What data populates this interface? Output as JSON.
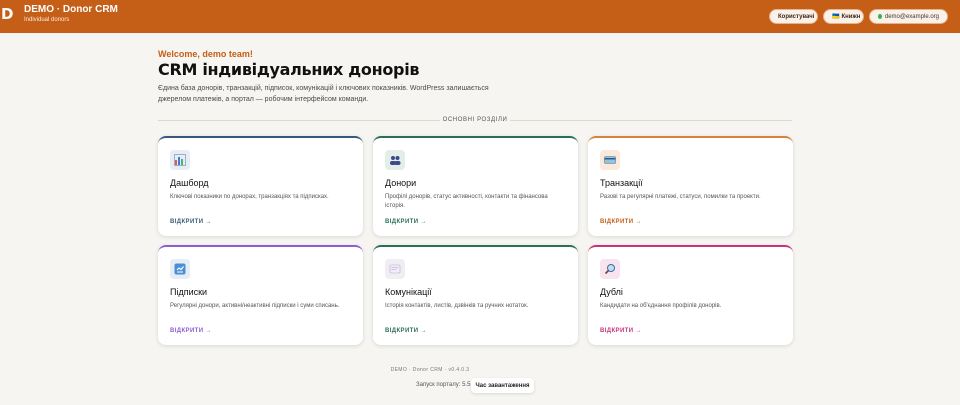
{
  "header": {
    "logo": "D",
    "title": "DEMO · Donor CRM",
    "subtitle": "Individual donors",
    "users_button": "Користувачі",
    "lang_flag": "🇺🇦",
    "lang_button": "Книжн",
    "user_email": "demo@example.org",
    "status_color": "#2fb45a"
  },
  "welcome": "Welcome, demo team!",
  "title": "CRM індивідуальних донорів",
  "lead": "Єдина база донорів, транзакцій, підписок, комунікацій і ключових показників. WordPress залишається джерелом платежів, а портал — робочим інтерфейсом команди.",
  "section_label": "ОСНОВНІ РОЗДІЛИ",
  "cards": [
    {
      "title": "Дашборд",
      "desc": "Ключові показники по донорах, транзакціях та підписках.",
      "link": "ВІДКРИТИ →",
      "icon": "chart-icon",
      "color": "#3a5a7c"
    },
    {
      "title": "Донори",
      "desc": "Профілі донорів, статус активності, контакти та фінансова історія.",
      "link": "ВІДКРИТИ →",
      "icon": "people-icon",
      "color": "#2c6e5a"
    },
    {
      "title": "Транзакції",
      "desc": "Разові та регулярні платежі, статуси, помилки та проекти.",
      "link": "ВІДКРИТИ →",
      "icon": "card-icon",
      "color": "#c55e16"
    },
    {
      "title": "Підписки",
      "desc": "Регулярні донори, активні/неактивні підписки і суми списань.",
      "link": "ВІДКРИТИ →",
      "icon": "subscription-icon",
      "color": "#8a5fd6"
    },
    {
      "title": "Комунікації",
      "desc": "Історія контактів, листів, дзвінків та ручних нотаток.",
      "link": "ВІДКРИТИ →",
      "icon": "message-icon",
      "color": "#2c6e5a"
    },
    {
      "title": "Дублі",
      "desc": "Кандидати на об'єднання профілів донорів.",
      "link": "ВІДКРИТИ →",
      "icon": "magnifier-icon",
      "color": "#c8347a"
    }
  ],
  "footer": {
    "version": "DEMO · Donor CRM · v0.4.0.3",
    "load_label": "Запуск порталу: 5.5 с",
    "load_button": "Час завантаження"
  }
}
